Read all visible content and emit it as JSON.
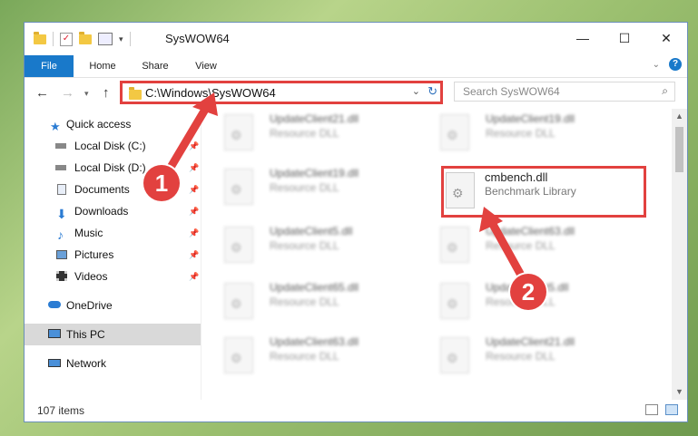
{
  "window": {
    "title": "SysWOW64",
    "controls": {
      "minimize": "—",
      "maximize": "☐",
      "close": "✕"
    }
  },
  "ribbon": {
    "tabs": [
      "File",
      "Home",
      "Share",
      "View"
    ]
  },
  "address": {
    "path": "C:\\Windows\\SysWOW64",
    "search_placeholder": "Search SysWOW64"
  },
  "nav": {
    "items": [
      {
        "label": "Quick access",
        "icon": "star-icon",
        "pinned": false
      },
      {
        "label": "Local Disk (C:)",
        "icon": "drive-icon",
        "pinned": true
      },
      {
        "label": "Local Disk (D:)",
        "icon": "drive-icon",
        "pinned": true
      },
      {
        "label": "Documents",
        "icon": "documents-icon",
        "pinned": true
      },
      {
        "label": "Downloads",
        "icon": "downloads-icon",
        "pinned": true
      },
      {
        "label": "Music",
        "icon": "music-icon",
        "pinned": true
      },
      {
        "label": "Pictures",
        "icon": "pictures-icon",
        "pinned": true
      },
      {
        "label": "Videos",
        "icon": "videos-icon",
        "pinned": true
      },
      {
        "label": "OneDrive",
        "icon": "onedrive-icon",
        "pinned": false
      },
      {
        "label": "This PC",
        "icon": "computer-icon",
        "pinned": false,
        "selected": true
      },
      {
        "label": "Network",
        "icon": "network-icon",
        "pinned": false
      }
    ]
  },
  "files": [
    {
      "name": "UpdateClient21.dll",
      "desc": "Resource DLL"
    },
    {
      "name": "UpdateClient19.dll",
      "desc": "Resource DLL"
    },
    {
      "name": "UpdateClient19.dll",
      "desc": "Resource DLL"
    },
    {
      "name": "cmbench.dll",
      "desc": "Benchmark Library",
      "highlighted": true
    },
    {
      "name": "UpdateClient5.dll",
      "desc": "Resource DLL"
    },
    {
      "name": "UpdateClient63.dll",
      "desc": "Resource DLL"
    },
    {
      "name": "UpdateClient65.dll",
      "desc": "Resource DLL"
    },
    {
      "name": "UpdateClient5.dll",
      "desc": "Resource DLL"
    },
    {
      "name": "UpdateClient63.dll",
      "desc": "Resource DLL"
    },
    {
      "name": "UpdateClient21.dll",
      "desc": "Resource DLL"
    }
  ],
  "status": {
    "items": "107 items"
  },
  "annotations": {
    "badge1": "1",
    "badge2": "2",
    "accent": "#e2413f"
  }
}
